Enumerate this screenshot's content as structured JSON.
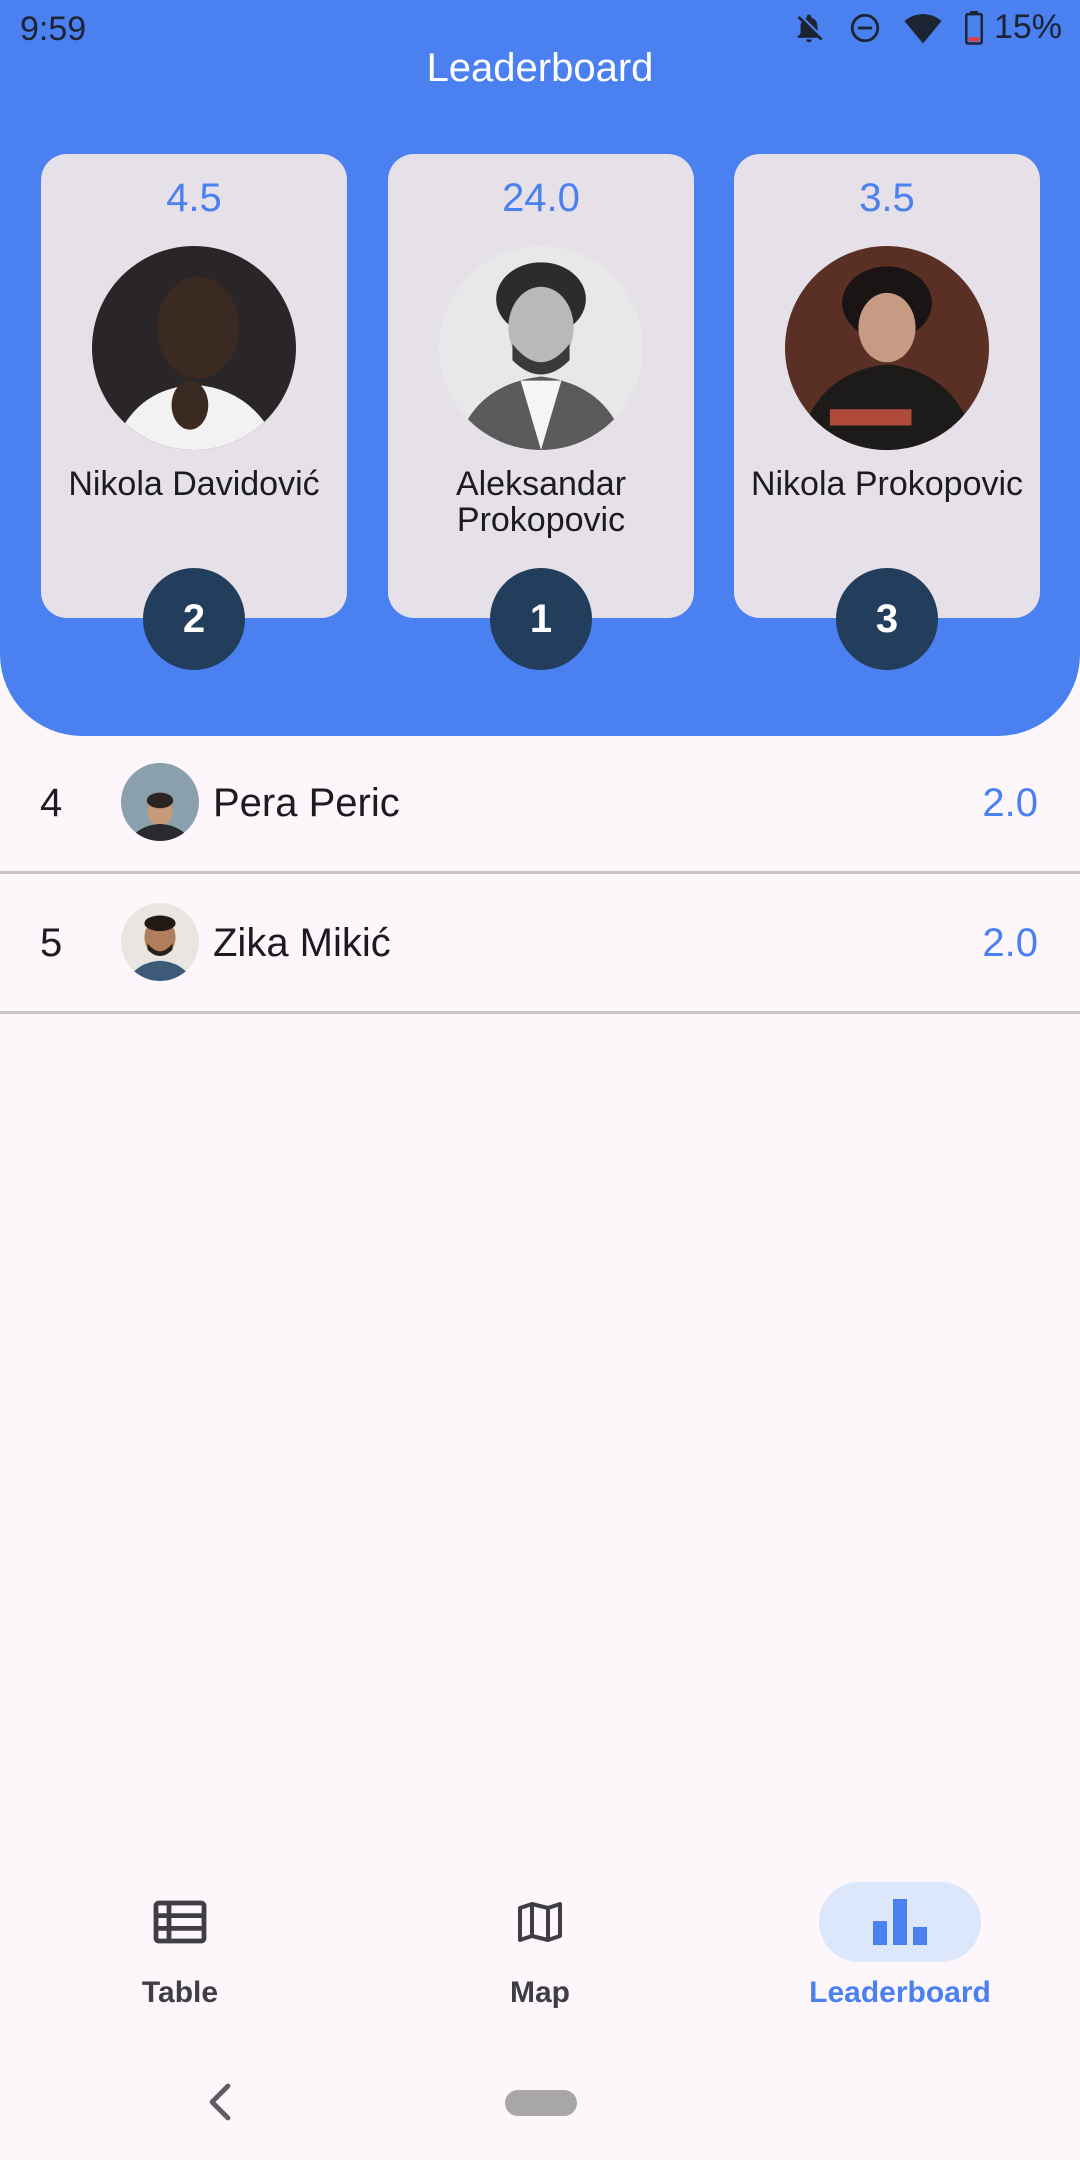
{
  "status_bar": {
    "time": "9:59",
    "battery": "15%",
    "icons": [
      "notifications-off-icon",
      "do-not-disturb-icon",
      "wifi-icon",
      "battery-icon"
    ]
  },
  "app_title": "Leaderboard",
  "colors": {
    "primary": "#4a80f0",
    "header_background": "#4a80f0",
    "card_background": "#e6e0e8",
    "rank_badge": "#233d5c",
    "page_background": "#fdf7fc"
  },
  "podium": [
    {
      "position": "left",
      "rank": "2",
      "score": "4.5",
      "name": "Nikola Davidović"
    },
    {
      "position": "center",
      "rank": "1",
      "score": "24.0",
      "name": "Aleksandar Prokopovic"
    },
    {
      "position": "right",
      "rank": "3",
      "score": "3.5",
      "name": "Nikola Prokopovic"
    }
  ],
  "list": [
    {
      "rank": "4",
      "name": "Pera Peric",
      "score": "2.0"
    },
    {
      "rank": "5",
      "name": "Zika Mikić",
      "score": "2.0"
    }
  ],
  "bottom_nav": {
    "items": [
      {
        "label": "Table",
        "icon": "table-icon",
        "active": false
      },
      {
        "label": "Map",
        "icon": "map-icon",
        "active": false
      },
      {
        "label": "Leaderboard",
        "icon": "leaderboard-icon",
        "active": true
      }
    ]
  },
  "system_nav": {
    "back": "back-icon",
    "home": "home-pill"
  }
}
